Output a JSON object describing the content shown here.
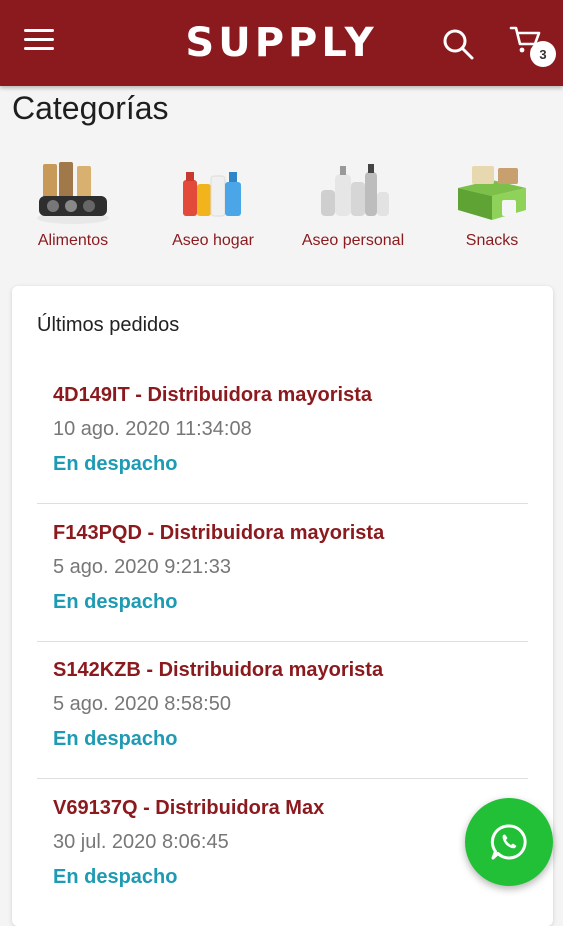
{
  "header": {
    "brand": "SUPPLY",
    "cart_count": "3"
  },
  "categories": {
    "title": "Categorías",
    "items": [
      {
        "label": "Alimentos"
      },
      {
        "label": "Aseo hogar"
      },
      {
        "label": "Aseo personal"
      },
      {
        "label": "Snacks"
      }
    ]
  },
  "orders": {
    "title": "Últimos pedidos",
    "items": [
      {
        "id": "4D149IT - Distribuidora mayorista",
        "date": "10 ago. 2020 11:34:08",
        "status": "En despacho"
      },
      {
        "id": "F143PQD - Distribuidora mayorista",
        "date": "5 ago. 2020 9:21:33",
        "status": "En despacho"
      },
      {
        "id": "S142KZB - Distribuidora mayorista",
        "date": "5 ago. 2020 8:58:50",
        "status": "En despacho"
      },
      {
        "id": "V69137Q - Distribuidora Max",
        "date": "30 jul. 2020 8:06:45",
        "status": "En despacho"
      }
    ]
  },
  "colors": {
    "primary": "#8b1a1e",
    "status": "#1e9bb4",
    "whatsapp": "#22c036"
  },
  "icons": [
    "menu-icon",
    "search-icon",
    "cart-icon",
    "whatsapp-icon"
  ]
}
